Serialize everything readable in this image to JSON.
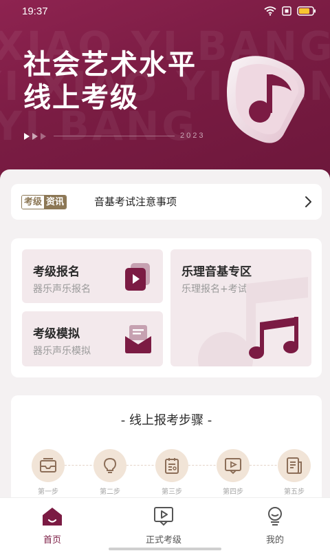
{
  "status_bar": {
    "time": "19:37"
  },
  "hero": {
    "title_line1": "社会艺术水平",
    "title_line2": "线上考级",
    "year": "2023",
    "watermark_lines": [
      "XIAO YI BANG",
      "YI XIAO YI BAN",
      "YI BANG"
    ]
  },
  "news": {
    "tag_left": "考级",
    "tag_right": "资讯",
    "text": "音基考试注意事项"
  },
  "menu": {
    "register": {
      "title": "考级报名",
      "subtitle": "器乐声乐报名"
    },
    "mock": {
      "title": "考级模拟",
      "subtitle": "器乐声乐模拟"
    },
    "theory": {
      "title": "乐理音基专区",
      "subtitle": "乐理报名+考试"
    }
  },
  "steps": {
    "title": "- 线上报考步骤 -",
    "items": [
      {
        "label": "第一步",
        "icon": "mail-icon"
      },
      {
        "label": "第二步",
        "icon": "lightbulb-icon"
      },
      {
        "label": "第三步",
        "icon": "clipboard-icon"
      },
      {
        "label": "第四步",
        "icon": "video-icon"
      },
      {
        "label": "第五步",
        "icon": "document-icon"
      }
    ]
  },
  "tabbar": {
    "items": [
      {
        "label": "首页",
        "icon": "home-icon",
        "active": true
      },
      {
        "label": "正式考级",
        "icon": "play-screen-icon",
        "active": false
      },
      {
        "label": "我的",
        "icon": "profile-icon",
        "active": false
      }
    ]
  },
  "colors": {
    "brand": "#7b1b43",
    "accent_gold": "#8c7755",
    "step_circle": "#f1e4d7",
    "card_bg": "#f3e9ec"
  }
}
